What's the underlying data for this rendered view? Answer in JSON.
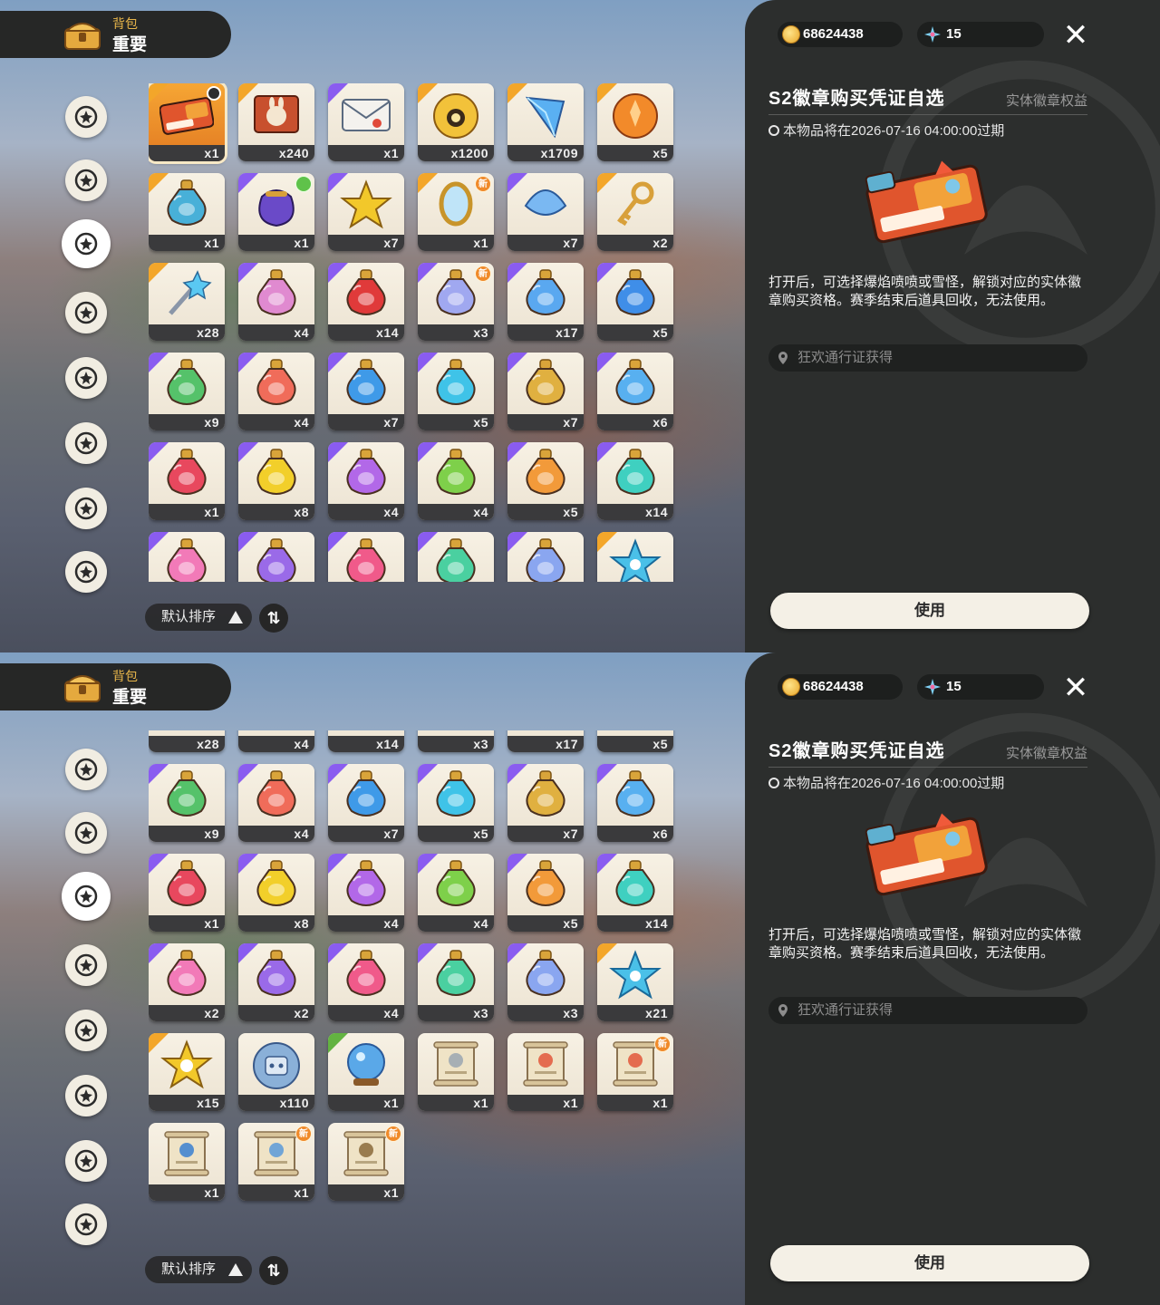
{
  "header": {
    "sub_label": "背包",
    "title": "重要"
  },
  "currency": {
    "coins": "68624438",
    "gems": "15"
  },
  "categories": [
    {
      "icon": "star-badge-icon"
    },
    {
      "icon": "leaf-sprout-icon"
    },
    {
      "icon": "sparkle-star-icon",
      "active": true
    },
    {
      "icon": "leaves-icon"
    },
    {
      "icon": "crown-card-icon"
    },
    {
      "icon": "cookie-icon"
    },
    {
      "icon": "acorn-icon"
    },
    {
      "icon": "sofa-icon"
    }
  ],
  "sort": {
    "label": "默认排序"
  },
  "detail": {
    "title": "S2徽章购买凭证自选",
    "tag": "实体徽章权益",
    "expiry": "本物品将在2026-07-16 04:00:00过期",
    "description": "打开后，可选择爆焰喷喷或雪怪，解锁对应的实体徽章购买资格。赛季结束后道具回收，无法使用。",
    "source": "狂欢通行证获得",
    "use_button": "使用"
  },
  "screens": [
    {
      "rows": [
        [
          {
            "qty": "x1",
            "icon": "voucher-ticket-icon",
            "rarity": "orange",
            "selected": true
          },
          {
            "qty": "x240",
            "icon": "bunny-card-icon",
            "rarity": "orange"
          },
          {
            "qty": "x1",
            "icon": "letter-envelope-icon",
            "rarity": "purple"
          },
          {
            "qty": "x1200",
            "icon": "camera-token-icon",
            "rarity": "orange"
          },
          {
            "qty": "x1709",
            "icon": "crystal-gem-icon",
            "rarity": "orange"
          },
          {
            "qty": "x5",
            "icon": "orange-crest-icon",
            "rarity": "orange"
          }
        ],
        [
          {
            "qty": "x1",
            "icon": "blue-bottle-icon",
            "rarity": "orange"
          },
          {
            "qty": "x1",
            "icon": "purple-pouch-icon",
            "rarity": "purple",
            "badge": "green"
          },
          {
            "qty": "x7",
            "icon": "gold-star-icon",
            "rarity": "purple"
          },
          {
            "qty": "x1",
            "icon": "mirror-icon",
            "rarity": "orange",
            "new": "新"
          },
          {
            "qty": "x7",
            "icon": "blue-shell-icon",
            "rarity": "purple"
          },
          {
            "qty": "x2",
            "icon": "gold-key-icon",
            "rarity": "orange"
          }
        ],
        [
          {
            "qty": "x28",
            "icon": "star-wand-icon",
            "rarity": "orange"
          },
          {
            "qty": "x4",
            "icon": "rainbow-potion-icon",
            "rarity": "purple"
          },
          {
            "qty": "x14",
            "icon": "red-vial-icon",
            "rarity": "purple"
          },
          {
            "qty": "x3",
            "icon": "prism-potion-icon",
            "rarity": "purple",
            "new": "新"
          },
          {
            "qty": "x17",
            "icon": "blue-flask-icon",
            "rarity": "purple"
          },
          {
            "qty": "x5",
            "icon": "blue-potion-icon",
            "rarity": "purple"
          }
        ],
        [
          {
            "qty": "x9",
            "icon": "green-potion-icon",
            "rarity": "purple"
          },
          {
            "qty": "x4",
            "icon": "coral-potion-icon",
            "rarity": "purple"
          },
          {
            "qty": "x7",
            "icon": "azure-potion-icon",
            "rarity": "purple"
          },
          {
            "qty": "x5",
            "icon": "cyan-potion-icon",
            "rarity": "purple"
          },
          {
            "qty": "x7",
            "icon": "amber-potion-icon",
            "rarity": "purple"
          },
          {
            "qty": "x6",
            "icon": "sky-potion-icon",
            "rarity": "purple"
          }
        ],
        [
          {
            "qty": "x1",
            "icon": "crimson-potion-icon",
            "rarity": "purple"
          },
          {
            "qty": "x8",
            "icon": "yellow-potion-icon",
            "rarity": "purple"
          },
          {
            "qty": "x4",
            "icon": "violet-potion-icon",
            "rarity": "purple"
          },
          {
            "qty": "x4",
            "icon": "lime-potion-icon",
            "rarity": "purple"
          },
          {
            "qty": "x5",
            "icon": "orange-potion-icon",
            "rarity": "purple"
          },
          {
            "qty": "x14",
            "icon": "teal-potion-icon",
            "rarity": "purple"
          }
        ],
        [
          {
            "qty": "",
            "icon": "pink-potion-icon",
            "rarity": "purple"
          },
          {
            "qty": "",
            "icon": "lilac-potion-icon",
            "rarity": "purple"
          },
          {
            "qty": "",
            "icon": "rose-potion-icon",
            "rarity": "purple"
          },
          {
            "qty": "",
            "icon": "mint-potion-icon",
            "rarity": "purple"
          },
          {
            "qty": "",
            "icon": "swirl-potion-icon",
            "rarity": "purple"
          },
          {
            "qty": "",
            "icon": "blue-star-icon",
            "rarity": "orange"
          }
        ]
      ]
    },
    {
      "rows": [
        [
          {
            "qty": "x28",
            "icon": "star-wand-icon",
            "rarity": "orange"
          },
          {
            "qty": "x4",
            "icon": "rainbow-potion-icon",
            "rarity": "purple"
          },
          {
            "qty": "x14",
            "icon": "red-vial-icon",
            "rarity": "purple"
          },
          {
            "qty": "x3",
            "icon": "prism-potion-icon",
            "rarity": "purple"
          },
          {
            "qty": "x17",
            "icon": "blue-flask-icon",
            "rarity": "purple"
          },
          {
            "qty": "x5",
            "icon": "blue-potion-icon",
            "rarity": "purple"
          }
        ],
        [
          {
            "qty": "x9",
            "icon": "green-potion-icon",
            "rarity": "purple"
          },
          {
            "qty": "x4",
            "icon": "coral-potion-icon",
            "rarity": "purple"
          },
          {
            "qty": "x7",
            "icon": "azure-potion-icon",
            "rarity": "purple"
          },
          {
            "qty": "x5",
            "icon": "cyan-potion-icon",
            "rarity": "purple"
          },
          {
            "qty": "x7",
            "icon": "amber-potion-icon",
            "rarity": "purple"
          },
          {
            "qty": "x6",
            "icon": "sky-potion-icon",
            "rarity": "purple"
          }
        ],
        [
          {
            "qty": "x1",
            "icon": "crimson-potion-icon",
            "rarity": "purple"
          },
          {
            "qty": "x8",
            "icon": "yellow-potion-icon",
            "rarity": "purple"
          },
          {
            "qty": "x4",
            "icon": "violet-potion-icon",
            "rarity": "purple"
          },
          {
            "qty": "x4",
            "icon": "lime-potion-icon",
            "rarity": "purple"
          },
          {
            "qty": "x5",
            "icon": "orange-potion-icon",
            "rarity": "purple"
          },
          {
            "qty": "x14",
            "icon": "teal-potion-icon",
            "rarity": "purple"
          }
        ],
        [
          {
            "qty": "x2",
            "icon": "pink-potion-icon",
            "rarity": "purple"
          },
          {
            "qty": "x2",
            "icon": "lilac-potion-icon",
            "rarity": "purple"
          },
          {
            "qty": "x4",
            "icon": "rose-potion-icon",
            "rarity": "purple"
          },
          {
            "qty": "x3",
            "icon": "mint-potion-icon",
            "rarity": "purple"
          },
          {
            "qty": "x3",
            "icon": "swirl-potion-icon",
            "rarity": "purple"
          },
          {
            "qty": "x21",
            "icon": "blue-star-icon",
            "rarity": "orange"
          }
        ],
        [
          {
            "qty": "x15",
            "icon": "gold-star-coin-icon",
            "rarity": "orange"
          },
          {
            "qty": "x110",
            "icon": "robot-coin-icon",
            "rarity": "none"
          },
          {
            "qty": "x1",
            "icon": "crystal-ball-icon",
            "rarity": "green"
          },
          {
            "qty": "x1",
            "icon": "scroll-icon",
            "rarity": "none"
          },
          {
            "qty": "x1",
            "icon": "scroll-fire-icon",
            "rarity": "none"
          },
          {
            "qty": "x1",
            "icon": "scroll-fire-icon",
            "rarity": "none",
            "new": "新"
          }
        ],
        [
          {
            "qty": "x1",
            "icon": "scroll-water-icon",
            "rarity": "none"
          },
          {
            "qty": "x1",
            "icon": "scroll-star-icon",
            "rarity": "none",
            "new": "新"
          },
          {
            "qty": "x1",
            "icon": "scroll-mountain-icon",
            "rarity": "none",
            "new": "新"
          }
        ]
      ]
    }
  ],
  "colors": {
    "panel_bg": "#2c2e2d",
    "rarity_purple": "#8a5cf0",
    "rarity_orange": "#f3a62a",
    "rarity_green": "#63b341",
    "header_gold": "#e7b54a",
    "new_badge": "#f08a2a"
  }
}
